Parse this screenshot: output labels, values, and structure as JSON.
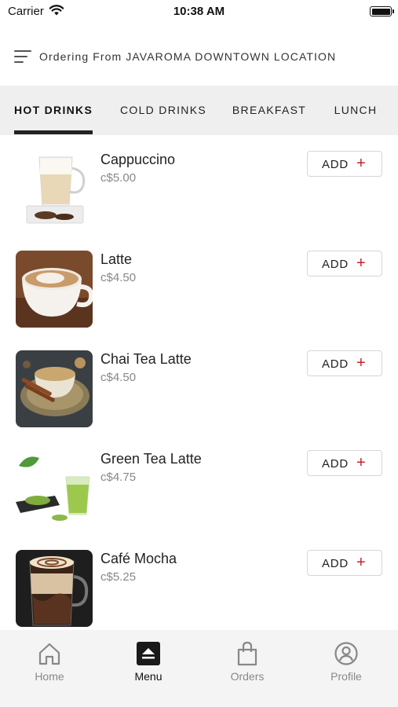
{
  "status_bar": {
    "carrier": "Carrier",
    "time": "10:38 AM"
  },
  "header": {
    "ordering_text": "Ordering From JAVAROMA DOWNTOWN LOCATION"
  },
  "tabs": [
    {
      "label": "HOT DRINKS",
      "active": true
    },
    {
      "label": "COLD DRINKS",
      "active": false
    },
    {
      "label": "BREAKFAST",
      "active": false
    },
    {
      "label": "LUNCH",
      "active": false
    }
  ],
  "menu": {
    "add_label": "ADD",
    "add_symbol": "+",
    "items": [
      {
        "name": "Cappuccino",
        "price": "c$5.00"
      },
      {
        "name": "Latte",
        "price": "c$4.50"
      },
      {
        "name": "Chai Tea Latte",
        "price": "c$4.50"
      },
      {
        "name": "Green Tea Latte",
        "price": "c$4.75"
      },
      {
        "name": "Café Mocha",
        "price": "c$5.25"
      }
    ]
  },
  "bottom_nav": [
    {
      "label": "Home",
      "icon": "home-icon",
      "active": false
    },
    {
      "label": "Menu",
      "icon": "menu-icon",
      "active": true
    },
    {
      "label": "Orders",
      "icon": "shopping-bag-icon",
      "active": false
    },
    {
      "label": "Profile",
      "icon": "profile-icon",
      "active": false
    }
  ],
  "colors": {
    "accent": "#c8202e",
    "tab_bar_bg": "#efefef",
    "nav_bg": "#f4f4f4"
  }
}
